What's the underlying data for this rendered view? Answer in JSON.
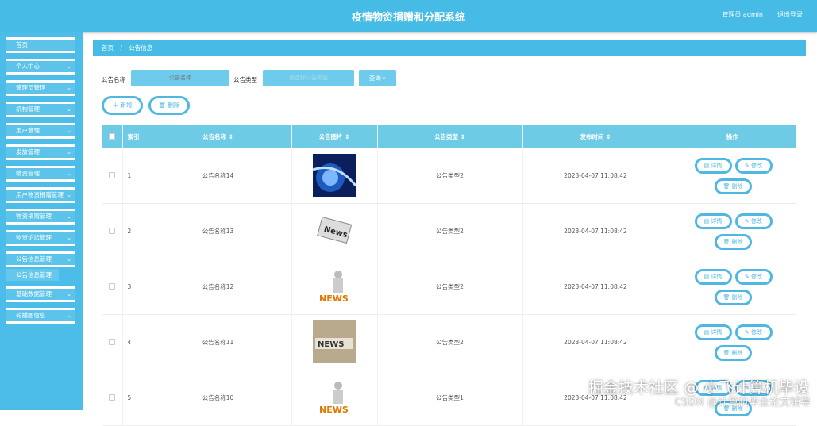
{
  "header": {
    "title": "疫情物资捐赠和分配系统",
    "user": "管理员 admin",
    "logout": "退出登录"
  },
  "sidebar": {
    "items": [
      {
        "label": "首页",
        "chev": false
      },
      {
        "label": "个人中心",
        "chev": true
      },
      {
        "label": "管理员管理",
        "chev": true
      },
      {
        "label": "机构管理",
        "chev": true
      },
      {
        "label": "用户管理",
        "chev": true
      },
      {
        "label": "发放管理",
        "chev": true
      },
      {
        "label": "物资管理",
        "chev": true
      },
      {
        "label": "用户物资捐赠管理",
        "chev": true
      },
      {
        "label": "物资捐赠管理",
        "chev": true
      },
      {
        "label": "物资论坛管理",
        "chev": true
      },
      {
        "label": "公告信息管理",
        "chev": true
      }
    ],
    "sub": "公告信息管理",
    "items2": [
      {
        "label": "基础数据管理"
      },
      {
        "label": "轮播图信息"
      }
    ]
  },
  "breadcrumb": {
    "home": "首页",
    "sep": "/",
    "current": "公告信息"
  },
  "search": {
    "name_label": "公告名称",
    "name_placeholder": "公告名称",
    "type_label": "公告类型",
    "type_placeholder": "请选择公告类型",
    "search_btn": "查询 ⌕"
  },
  "actions": {
    "add": "＋ 新增",
    "delete": "🗑 删除"
  },
  "table": {
    "headers": [
      "索引",
      "公告名称 ⇕",
      "公告图片 ⇕",
      "公告类型 ⇕",
      "发布时间 ⇕",
      "操作"
    ],
    "ops": {
      "detail": "▤ 详情",
      "edit": "✎ 修改",
      "delete": "🗑 删除"
    },
    "rows": [
      {
        "index": "1",
        "name": "公告名称14",
        "image": "blue-tech",
        "type": "公告类型2",
        "time": "2023-04-07 11:08:42"
      },
      {
        "index": "2",
        "name": "公告名称13",
        "image": "news-paper",
        "type": "公告类型2",
        "time": "2023-04-07 11:08:42"
      },
      {
        "index": "3",
        "name": "公告名称12",
        "image": "news-figure",
        "type": "公告类型2",
        "time": "2023-04-07 11:08:42"
      },
      {
        "index": "4",
        "name": "公告名称11",
        "image": "news-blocks",
        "type": "公告类型2",
        "time": "2023-04-07 11:08:42"
      },
      {
        "index": "5",
        "name": "公告名称10",
        "image": "news-figure",
        "type": "公告类型1",
        "time": "2023-04-07 11:08:42"
      }
    ]
  },
  "watermark": {
    "line1": "掘金技术社区 @ 小飞计算机毕设",
    "line2": "CSDN @计算机毕业论文辅导"
  }
}
